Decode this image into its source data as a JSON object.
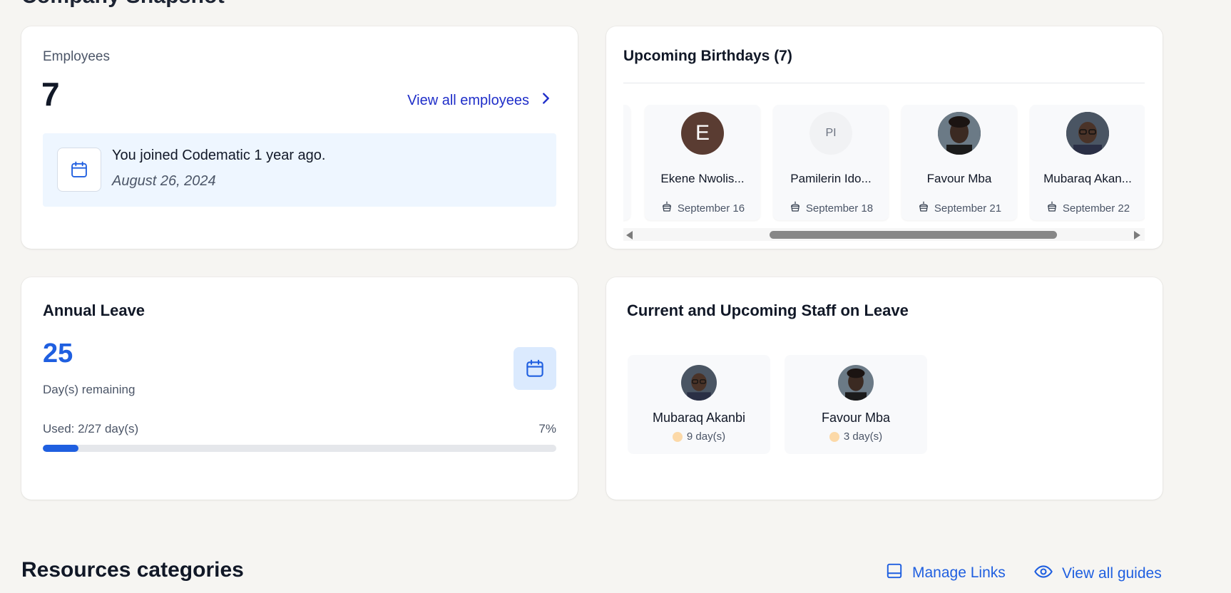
{
  "top_heading_cut": "Company Snapshot",
  "employees": {
    "title": "Employees",
    "count": "7",
    "view_all_label": "View all employees",
    "joined_text": "You joined Codematic 1 year ago.",
    "joined_date": "August 26, 2024"
  },
  "birthdays": {
    "title": "Upcoming Birthdays (7)",
    "items": [
      {
        "name": "Ekene Nwolis...",
        "initials": "E",
        "date": "September 16",
        "avatar_color": "#5a3c32"
      },
      {
        "name": "Pamilerin Ido...",
        "initials": "PI",
        "date": "September 18",
        "avatar_color": "#f1f2f4"
      },
      {
        "name": "Favour Mba",
        "initials": "",
        "date": "September 21",
        "avatar_color": "#3a3a3a"
      },
      {
        "name": "Mubaraq Akan...",
        "initials": "",
        "date": "September 22",
        "avatar_color": "#3a3a3a"
      }
    ]
  },
  "annual_leave": {
    "title": "Annual Leave",
    "remaining": "25",
    "remaining_label": "Day(s) remaining",
    "used_label": "Used: 2/27 day(s)",
    "used_percent_label": "7%",
    "used_fraction": 0.07
  },
  "staff_on_leave": {
    "title": "Current and Upcoming Staff on Leave",
    "items": [
      {
        "name": "Mubaraq Akanbi",
        "days": "9 day(s)"
      },
      {
        "name": "Favour Mba",
        "days": "3 day(s)"
      }
    ]
  },
  "resources": {
    "title": "Resources categories",
    "manage_links_label": "Manage Links",
    "view_guides_label": "View all guides"
  },
  "colors": {
    "accent": "#1f5fe0",
    "link": "#1f2ec9",
    "background": "#f6f5f2"
  }
}
